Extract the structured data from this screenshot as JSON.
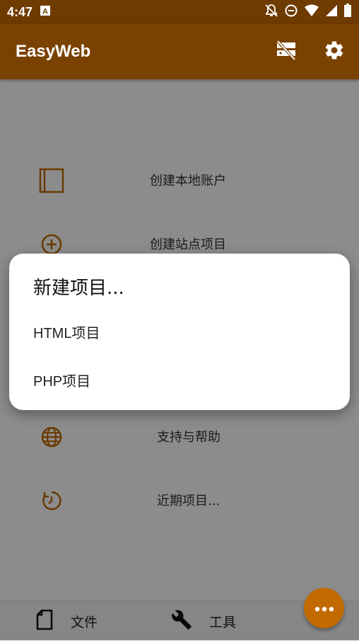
{
  "status_bar": {
    "time": "4:47",
    "icons": [
      "a-notification-icon",
      "bell-off-icon",
      "do-not-disturb-icon",
      "wifi-icon",
      "signal-icon",
      "battery-icon"
    ]
  },
  "app_bar": {
    "title": "EasyWeb",
    "actions": [
      "server-off-icon",
      "settings-icon"
    ]
  },
  "menu": {
    "items": [
      {
        "label": "创建本地账户",
        "icon": "square-frame-icon"
      },
      {
        "label": "创建站点项目",
        "icon": "add-circle-icon"
      },
      {
        "label": "支持与帮助",
        "icon": "globe-icon"
      },
      {
        "label": "近期项目...",
        "icon": "history-icon"
      }
    ]
  },
  "bottom_nav": {
    "files_label": "文件",
    "tools_label": "工具"
  },
  "dialog": {
    "title": "新建项目...",
    "options": [
      "HTML项目",
      "PHP项目"
    ]
  },
  "colors": {
    "accent": "#c26a00",
    "app_bar": "#7a4200",
    "status_bar": "#6e3b00"
  }
}
